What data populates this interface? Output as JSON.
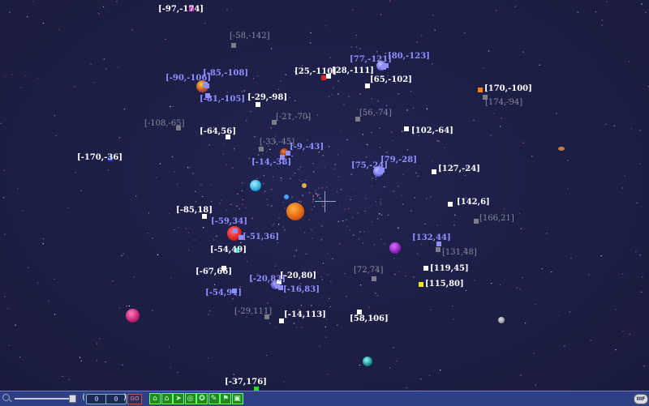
{
  "own_systems": [
    {
      "label": "[-97,-174]",
      "color": "#c040c0"
    },
    {
      "label": "[25,-110]",
      "color": "#e02020"
    },
    {
      "label": "[28,-111]",
      "color": "#ffffff"
    },
    {
      "label": "[65,-102]",
      "color": "#ffffff"
    },
    {
      "label": "[170,-100]",
      "color": "#ff8000"
    },
    {
      "label": "[-29,-98]",
      "color": "#ffffff"
    },
    {
      "label": "[-64,56]",
      "color": "#ffffff"
    },
    {
      "label": "[102,-64]",
      "color": "#ffffff"
    },
    {
      "label": "[-170,-36]",
      "color": "#2040e0"
    },
    {
      "label": "[127,-24]",
      "color": "#ffffff"
    },
    {
      "label": "[142,6]",
      "color": "#ffffff"
    },
    {
      "label": "[-85,18]",
      "color": "#ffffff"
    },
    {
      "label": "[-54,49]",
      "color": "#20e0e0"
    },
    {
      "label": "[-67,66]",
      "color": "#ffffff"
    },
    {
      "label": "[119,45]",
      "color": "#ffffff"
    },
    {
      "label": "[115,80]",
      "color": "#f0e020"
    },
    {
      "label": "[-20,80]",
      "color": "#ffffff"
    },
    {
      "label": "[-14,113]",
      "color": "#ffffff"
    },
    {
      "label": "[58,106]",
      "color": "#ffffff"
    },
    {
      "label": "[-37,176]",
      "color": "#20e020"
    }
  ],
  "ally_systems": [
    {
      "label": "[77,-121]"
    },
    {
      "label": "[80,-123]"
    },
    {
      "label": "[-90,-106]"
    },
    {
      "label": "[-85,-108]"
    },
    {
      "label": "[-81,-105]"
    },
    {
      "label": "[-9,-43]"
    },
    {
      "label": "[-14,-38]"
    },
    {
      "label": "[75,-24]"
    },
    {
      "label": "[79,-28]"
    },
    {
      "label": "[-59,34]"
    },
    {
      "label": "[-51,36]"
    },
    {
      "label": "[132,44]"
    },
    {
      "label": "[-20,83]"
    },
    {
      "label": "[-16,83]"
    },
    {
      "label": "[-54,91]"
    }
  ],
  "neutral_systems": [
    {
      "label": "[-58,-142]"
    },
    {
      "label": "[174,-94]"
    },
    {
      "label": "[-108,-65]"
    },
    {
      "label": "[-21,-70]"
    },
    {
      "label": "[56,-74]"
    },
    {
      "label": "[-33,-45]"
    },
    {
      "label": "[166,21]"
    },
    {
      "label": "[131,48]"
    },
    {
      "label": "[72,74]"
    },
    {
      "label": "[-29,111]"
    }
  ],
  "toolbar": {
    "zoom_icon": "magnifier-icon",
    "coord_x": "0",
    "coord_y": "0",
    "go_label": "GO",
    "tools": [
      "home",
      "home",
      "ship",
      "ring",
      "star",
      "edit",
      "flag",
      "box"
    ],
    "right_label": "IIIF"
  }
}
